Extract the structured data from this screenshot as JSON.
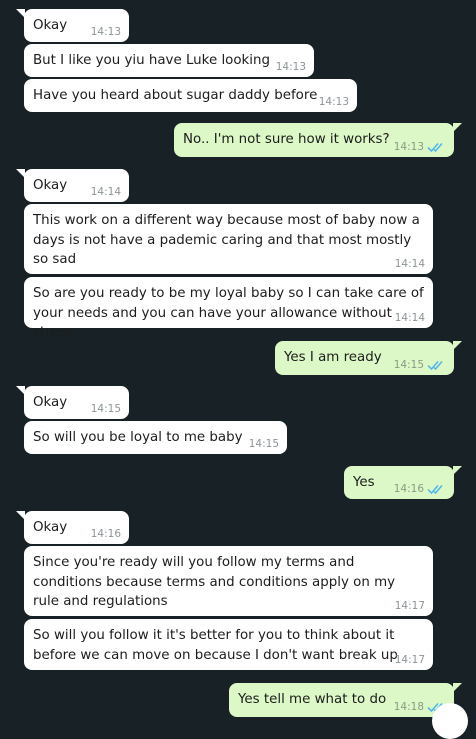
{
  "chat": {
    "messages": [
      {
        "dir": "in",
        "text": "Okay",
        "time": "14:13"
      },
      {
        "dir": "in",
        "text": "But I like you yiu have Luke looking",
        "time": "14:13"
      },
      {
        "dir": "in",
        "text": "Have you heard about sugar daddy before",
        "time": "14:13"
      },
      {
        "dir": "out",
        "text": "No.. I'm not sure how it works?",
        "time": "14:13",
        "status": "read"
      },
      {
        "dir": "in",
        "text": "Okay",
        "time": "14:14"
      },
      {
        "dir": "in",
        "text": "This work on a different way because most of baby now a days is not have a pademic caring and that most mostly so sad",
        "time": "14:14"
      },
      {
        "dir": "in",
        "text": "So are you ready to be my loyal baby so I can take care of your needs and you can have your allowance without stress",
        "time": "14:14"
      },
      {
        "dir": "out",
        "text": "Yes I am ready",
        "time": "14:15",
        "status": "read"
      },
      {
        "dir": "in",
        "text": "Okay",
        "time": "14:15"
      },
      {
        "dir": "in",
        "text": "So will you be loyal to me baby",
        "time": "14:15"
      },
      {
        "dir": "out",
        "text": "Yes",
        "time": "14:16",
        "status": "read"
      },
      {
        "dir": "in",
        "text": "Okay",
        "time": "14:16"
      },
      {
        "dir": "in",
        "text": "Since you're ready will you follow my terms and conditions because terms and conditions apply on my rule and regulations",
        "time": "14:17"
      },
      {
        "dir": "in",
        "text": "So will you follow it it's better for you to think about it before we can move on because I don't want break up",
        "time": "14:17"
      },
      {
        "dir": "out",
        "text": "Yes tell me what to do",
        "time": "14:18",
        "status": "read"
      }
    ]
  },
  "colors": {
    "background": "#182226",
    "incoming_bubble": "#ffffff",
    "outgoing_bubble": "#dcf8c6",
    "read_ticks": "#4fb6ec"
  },
  "icons": {
    "read_receipt": "double-check-icon",
    "scroll_button": "scroll-down-button"
  }
}
